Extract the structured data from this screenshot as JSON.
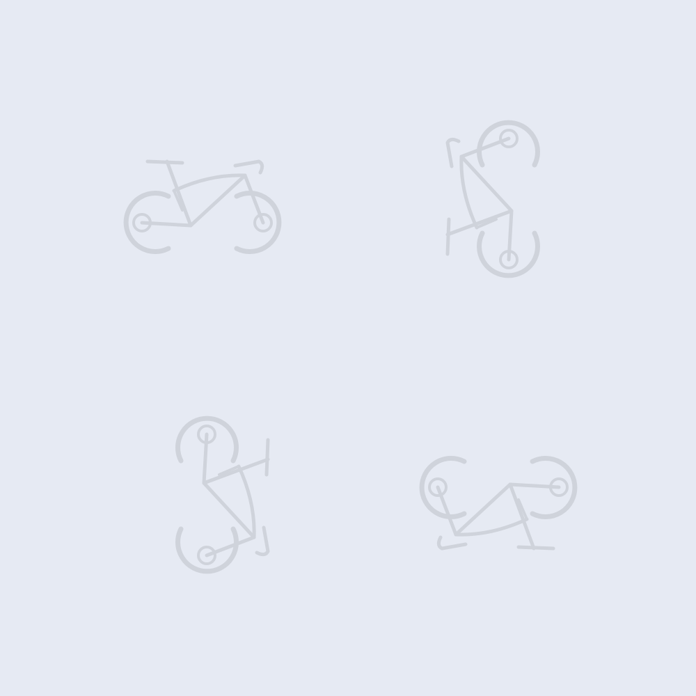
{
  "background_color": "#e6eaf3",
  "pattern": {
    "motif_icon": "bicycle-icon",
    "motif_color": "#cfd3db",
    "motif_count": 4,
    "orientations": [
      "upright",
      "rotated-left",
      "rotated-right",
      "upside-down"
    ]
  }
}
